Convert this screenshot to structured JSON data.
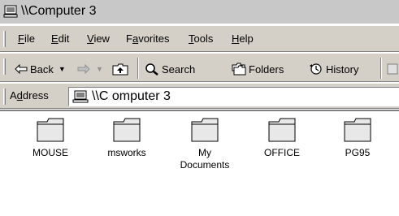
{
  "window": {
    "title": "\\\\Computer 3"
  },
  "menu": {
    "items": [
      {
        "key": "F",
        "rest": "ile"
      },
      {
        "key": "E",
        "rest": "dit"
      },
      {
        "key": "V",
        "rest": "iew"
      },
      {
        "pre": "F",
        "key": "a",
        "rest": "vorites"
      },
      {
        "key": "T",
        "rest": "ools"
      },
      {
        "key": "H",
        "rest": "elp"
      }
    ]
  },
  "toolbar": {
    "back_label": "Back",
    "search_label": "Search",
    "folders_label": "Folders",
    "history_label": "History"
  },
  "address": {
    "label_pre": "A",
    "label_key": "d",
    "label_rest": "dress",
    "value": "\\\\C omputer 3"
  },
  "folders": [
    {
      "name": "MOUSE"
    },
    {
      "name": "msworks"
    },
    {
      "name": "My Documents"
    },
    {
      "name": "OFFICE"
    },
    {
      "name": "PG95"
    }
  ],
  "icons": {
    "computer": "computer-icon",
    "back": "back-arrow-icon",
    "forward": "forward-arrow-icon",
    "up": "up-folder-icon",
    "search": "search-icon",
    "folders": "folders-icon",
    "history": "history-icon",
    "folder": "folder-icon"
  }
}
